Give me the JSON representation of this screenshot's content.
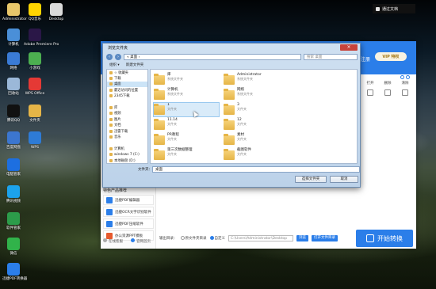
{
  "desktop": {
    "icons": [
      {
        "label": "Administrator",
        "color": "#e8c66a"
      },
      {
        "label": "QQ音乐",
        "color": "#ffd400"
      },
      {
        "label": "Desktop",
        "color": "#d9d9d9"
      },
      {
        "label": "计算机",
        "color": "#4a8fd8"
      },
      {
        "label": "Adobe Premiere Pro",
        "color": "#2a1747"
      },
      {
        "label": "网络",
        "color": "#3a7bd5"
      },
      {
        "label": "小游戏",
        "color": "#4caf50"
      },
      {
        "label": "回收站",
        "color": "#9bb8d8"
      },
      {
        "label": "WPS Office",
        "color": "#e53935"
      },
      {
        "label": "腾讯QQ",
        "color": "#111111"
      },
      {
        "label": "文件夹",
        "color": "#e6b547"
      },
      {
        "label": "百度网盘",
        "color": "#3c76cf"
      },
      {
        "label": "WPS",
        "color": "#2e7bd6"
      },
      {
        "label": "电脑管家",
        "color": "#1d6fe0"
      },
      {
        "label": "腾讯视频",
        "color": "#1ca3ec"
      },
      {
        "label": "软件管家",
        "color": "#2c9c4a"
      },
      {
        "label": "微信",
        "color": "#31b34a"
      },
      {
        "label": "迅捷PDF转换器",
        "color": "#2b7ee9"
      }
    ]
  },
  "notice": {
    "label": "通过文档"
  },
  "app": {
    "top_title": "注册",
    "vip_label": "VIP 特权",
    "toolbar": [
      {
        "label": "打开"
      },
      {
        "label": "删除"
      },
      {
        "label": "清除"
      }
    ],
    "sidebar_title": "特色产品推荐",
    "sidebar_items": [
      {
        "label": "迅捷PDF编辑器"
      },
      {
        "label": "迅捷OCR文字识别软件"
      },
      {
        "label": "迅捷PDF压缩软件"
      },
      {
        "label": "办公资源PPT模板"
      }
    ],
    "sidebar_bottom": [
      {
        "label": "在线客服"
      },
      {
        "label": "官网首页"
      }
    ],
    "output": {
      "label": "输出目录：",
      "opt1": "原文件夹目录",
      "opt2": "自定义",
      "path": "C:\\Users\\Administrator\\Desktop",
      "browse": "浏览",
      "open_dir": "打开文件目录"
    },
    "start_button": "开始转换"
  },
  "dialog": {
    "title": "浏览文件夹",
    "close": "×",
    "address": "« 桌面 ›",
    "search_placeholder": "搜索 桌面",
    "cmd": [
      "组织 ▾",
      "新建文件夹"
    ],
    "tree": [
      {
        "label": "☆ 收藏夹",
        "selected": false
      },
      {
        "label": "下载",
        "selected": false
      },
      {
        "label": "桌面",
        "selected": true
      },
      {
        "label": "最近访问的位置",
        "selected": false
      },
      {
        "label": "2345下载",
        "selected": false
      },
      {
        "label": "",
        "selected": false
      },
      {
        "label": "库",
        "selected": false
      },
      {
        "label": "视频",
        "selected": false
      },
      {
        "label": "图片",
        "selected": false
      },
      {
        "label": "文档",
        "selected": false
      },
      {
        "label": "迅雷下载",
        "selected": false
      },
      {
        "label": "音乐",
        "selected": false
      },
      {
        "label": "",
        "selected": false
      },
      {
        "label": "计算机",
        "selected": false
      },
      {
        "label": "windows 7 (C:)",
        "selected": false
      },
      {
        "label": "本地磁盘 (D:)",
        "selected": false
      }
    ],
    "files": [
      {
        "name": "库",
        "type": "系统文件夹",
        "selected": false
      },
      {
        "name": "Administrator",
        "type": "系统文件夹",
        "selected": false
      },
      {
        "name": "计算机",
        "type": "系统文件夹",
        "selected": false
      },
      {
        "name": "网络",
        "type": "系统文件夹",
        "selected": false
      },
      {
        "name": "1",
        "type": "文件夹",
        "selected": true
      },
      {
        "name": "3",
        "type": "文件夹",
        "selected": false
      },
      {
        "name": "11.14",
        "type": "文件夹",
        "selected": false
      },
      {
        "name": "12",
        "type": "文件夹",
        "selected": false
      },
      {
        "name": "PR教程",
        "type": "文件夹",
        "selected": false
      },
      {
        "name": "素材",
        "type": "文件夹",
        "selected": false
      },
      {
        "name": "第三次数据整理",
        "type": "文件夹",
        "selected": false
      },
      {
        "name": "截图软件",
        "type": "文件夹",
        "selected": false
      }
    ],
    "folder_label": "文件夹：",
    "folder_value": "桌面",
    "btn_select": "选择文件夹",
    "btn_cancel": "取消"
  }
}
